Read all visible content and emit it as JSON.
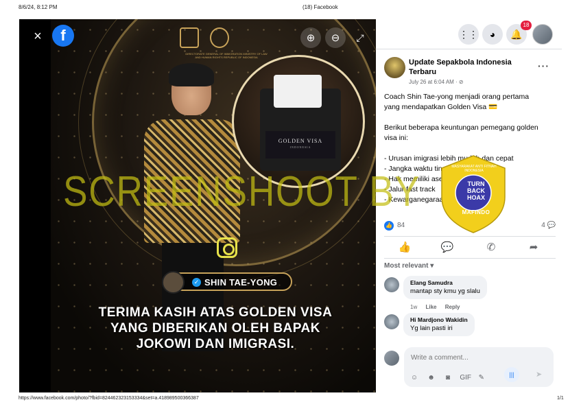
{
  "print": {
    "date": "8/6/24, 8:12 PM",
    "title": "(18) Facebook",
    "url": "https://www.facebook.com/photo/?fbid=824462323153334&set=a.418989500366387",
    "page": "1/1"
  },
  "viewer": {
    "close_icon": "×",
    "fb_logo": "f",
    "zoom_in_icon": "⊕",
    "zoom_out_icon": "⊖",
    "fullscreen_icon": "⤢"
  },
  "photo": {
    "emblem_text": "DIRECTORATE GENERAL OF IMMIGRATION MINISTRY OF LAW AND HUMAN RIGHTS REPUBLIC OF INDONESIA",
    "visa_card_title": "GOLDEN VISA",
    "visa_card_sub": "INDONESIA",
    "name_pill": "SHIN TAE-YONG",
    "verified_icon": "✓",
    "caption_lines": [
      "TERIMA KASIH ATAS GOLDEN VISA",
      "YANG DIBERIKAN OLEH BAPAK",
      "JOKOWI DAN IMIGRASI."
    ]
  },
  "nav": {
    "menu_icon": "⋮⋮",
    "messenger_icon": "◕",
    "notification_icon": "🔔",
    "notification_badge": "18"
  },
  "post": {
    "author": "Update Sepakbola Indonesia Terbaru",
    "meta": "July 26 at 6:04 AM · ⊘",
    "more_icon": "···",
    "text": {
      "l1": "Coach Shin Tae-yong menjadi orang pertama",
      "l2": "yang mendapatkan Golden Visa 💳",
      "l3": "Berikut beberapa keuntungan pemegang golden",
      "l4": "visa ini:",
      "l5": "- Urusan imigrasi lebih mudah dan cepat",
      "l6": "- Jangka waktu tinggal 5-10 tahun",
      "l7": "- Hak memiliki aset",
      "l8": "- Jalur fast track",
      "l9": "- Kewarganegaraan"
    },
    "like_icon": "👍",
    "like_count": "84",
    "comment_count": "4 💬",
    "actions": {
      "like": "👍",
      "comment": "💬",
      "whatsapp": "✆",
      "share": "➦"
    },
    "sort_label": "Most relevant ▾",
    "comments": [
      {
        "author": "Elang Samudra",
        "body": "mantap sty kmu yg slalu",
        "time": "1w",
        "like": "Like",
        "reply": "Reply"
      },
      {
        "author": "Hi Mardjono Wakidin",
        "body": "Yg lain pasti iri"
      }
    ],
    "composer": {
      "placeholder": "Write a comment...",
      "tools": [
        "☺",
        "☻",
        "◙",
        "GIF",
        "✎"
      ],
      "voice_icon": "|||",
      "send_icon": "➤"
    }
  },
  "watermark": {
    "text": "SCREENSHOOT BY",
    "seal_arc": "MASYARAKAT ANTI FITNAH INDONESIA",
    "seal_l1": "TURN",
    "seal_l2": "BACK",
    "seal_l3": "HOAX",
    "seal_bottom": "MAFINDO",
    "seal_color": "#f2cf1c",
    "seal_inner": "#3b3aa8"
  }
}
